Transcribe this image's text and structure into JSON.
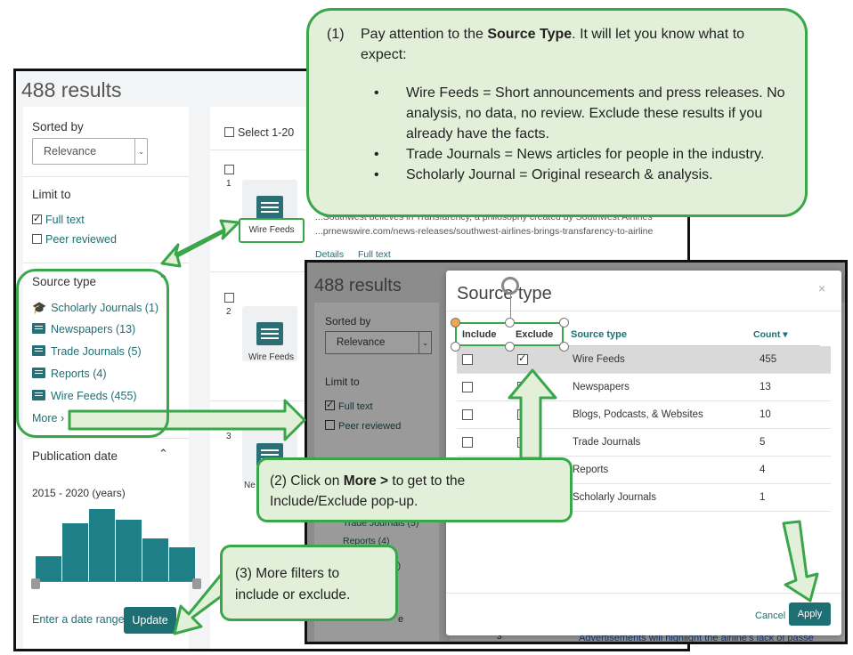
{
  "left": {
    "results_title": "488 results",
    "sorted_by": "Sorted by",
    "sort_value": "Relevance",
    "limit_to": "Limit to",
    "full_text": "Full text",
    "peer_reviewed": "Peer reviewed",
    "source_type_heading": "Source type",
    "source_types": [
      "Scholarly Journals (1)",
      "Newspapers (13)",
      "Trade Journals (5)",
      "Reports (4)",
      "Wire Feeds (455)"
    ],
    "more": "More ›",
    "pub_date": "Publication date",
    "date_range": "2015 - 2020 (years)",
    "histogram": [
      30,
      68,
      84,
      72,
      50,
      40
    ],
    "enter_date": "Enter a date range",
    "update": "Update"
  },
  "results": {
    "select": "Select 1-20",
    "items": [
      {
        "num": "1",
        "type": "Wire Feeds"
      },
      {
        "num": "2",
        "type": "Wire Feeds"
      },
      {
        "num": "3",
        "type": "Ne"
      }
    ],
    "snippet1": "...Southwest believes in Transfarency, a philosophy created by Southwest Airlines",
    "snippet2": "...prnewswire.com/news-releases/southwest-airlines-brings-transfarency-to-airline",
    "details": "Details",
    "full_text_link": "Full text"
  },
  "second": {
    "results_title": "488 results",
    "sorted_by": "Sorted by",
    "sort_value": "Relevance",
    "limit_to": "Limit to",
    "full_text": "Full text",
    "peer_reviewed": "Peer reviewed",
    "trade": "Trade Journals (5)",
    "reports": "Reports (4)",
    "count_tail": "55)",
    "de": "e",
    "ad_text": "Advertisements will highlight the airline's lack of passe",
    "item3": "3"
  },
  "modal": {
    "title": "Source type",
    "col_include": "Include",
    "col_exclude": "Exclude",
    "col_source": "Source type",
    "col_count": "Count ▾",
    "rows": [
      {
        "name": "Wire Feeds",
        "count": "455",
        "excluded": true
      },
      {
        "name": "Newspapers",
        "count": "13",
        "excluded": false
      },
      {
        "name": "Blogs, Podcasts, & Websites",
        "count": "10",
        "excluded": false
      },
      {
        "name": "Trade Journals",
        "count": "5",
        "excluded": false
      },
      {
        "name": "Reports",
        "count": "4",
        "excluded": false
      },
      {
        "name": "Scholarly Journals",
        "count": "1",
        "excluded": false
      }
    ],
    "cancel": "Cancel",
    "apply": "Apply"
  },
  "callouts": {
    "c1_num": "(1)",
    "c1_pre": "Pay attention to the ",
    "c1_bold": "Source Type",
    "c1_post": ". It will let you know what to expect:",
    "c1_bullets": [
      "Wire Feeds = Short announcements and press releases. No analysis, no data, no review. Exclude these results if you already have the facts.",
      "Trade Journals = News articles for people in the industry.",
      "Scholarly Journal = Original research & analysis."
    ],
    "c2_pre": "(2) Click on ",
    "c2_bold": "More >",
    "c2_post": " to get to the Include/Exclude pop-up.",
    "c3": "(3) More filters to include or exclude."
  },
  "colors": {
    "accent": "#1e6f74",
    "callout_bg": "#e2f0d9",
    "callout_border": "#3aa64a"
  }
}
